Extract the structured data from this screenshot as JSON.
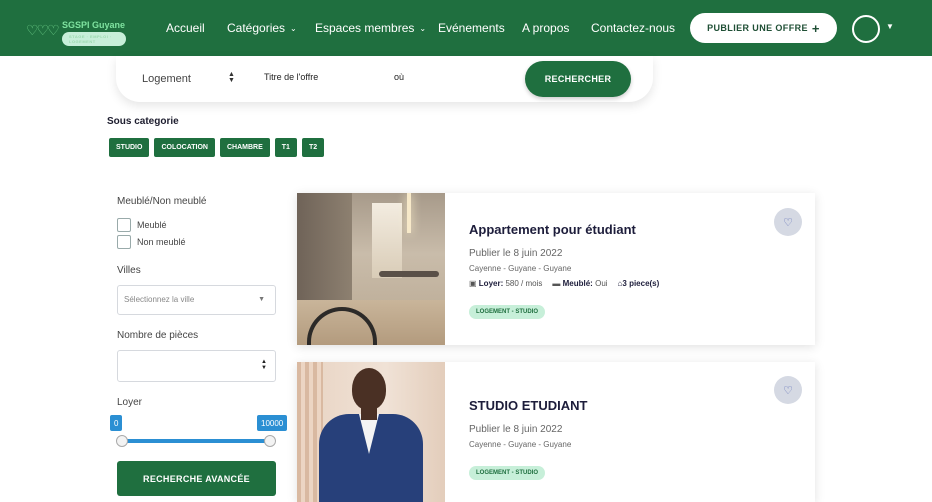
{
  "logo": {
    "brand": "SGSPI Guyane",
    "tagline": "STAGE · EMPLOI · LOGEMENT"
  },
  "nav": {
    "items": [
      {
        "label": "Accueil",
        "dropdown": false
      },
      {
        "label": "Catégories",
        "dropdown": true
      },
      {
        "label": "Espaces membres",
        "dropdown": true
      },
      {
        "label": "Evénements",
        "dropdown": false
      },
      {
        "label": "A propos",
        "dropdown": false
      },
      {
        "label": "Contactez-nous",
        "dropdown": false
      }
    ],
    "publish_label": "PUBLIER UNE OFFRE",
    "publish_icon": "plus-icon"
  },
  "search": {
    "type_value": "Logement",
    "title_placeholder": "Titre de l'offre",
    "where_placeholder": "où",
    "button_label": "RECHERCHER"
  },
  "subcategories": {
    "title": "Sous categorie",
    "chips": [
      "STUDIO",
      "COLOCATION",
      "CHAMBRE",
      "T1",
      "T2"
    ]
  },
  "filters": {
    "furnished_label": "Meublé/Non meublé",
    "furnished_options": [
      "Meublé",
      "Non meublé"
    ],
    "city_label": "Villes",
    "city_placeholder": "Sélectionnez la ville",
    "rooms_label": "Nombre de pièces",
    "rent_label": "Loyer",
    "rent_min": "0",
    "rent_max": "10000",
    "advanced_button": "RECHERCHE AVANCÉE"
  },
  "listings": [
    {
      "title": "Appartement pour étudiant",
      "published": "Publier le 8 juin 2022",
      "location": "Cayenne - Guyane - Guyane",
      "rent_label": "Loyer:",
      "rent_value": "580 / mois",
      "furnished_label": "Meublé:",
      "furnished_value": "Oui",
      "rooms": "3 piece(s)",
      "tag": "LOGEMENT - STUDIO",
      "favorite_icon": "heart-icon"
    },
    {
      "title": "STUDIO ETUDIANT",
      "published": "Publier le 8 juin 2022",
      "location": "Cayenne - Guyane - Guyane",
      "tag": "LOGEMENT - STUDIO",
      "favorite_icon": "heart-icon"
    }
  ],
  "colors": {
    "primary": "#1f6f3f",
    "slider": "#2b8fd3",
    "tag_bg": "#c7efd9"
  }
}
